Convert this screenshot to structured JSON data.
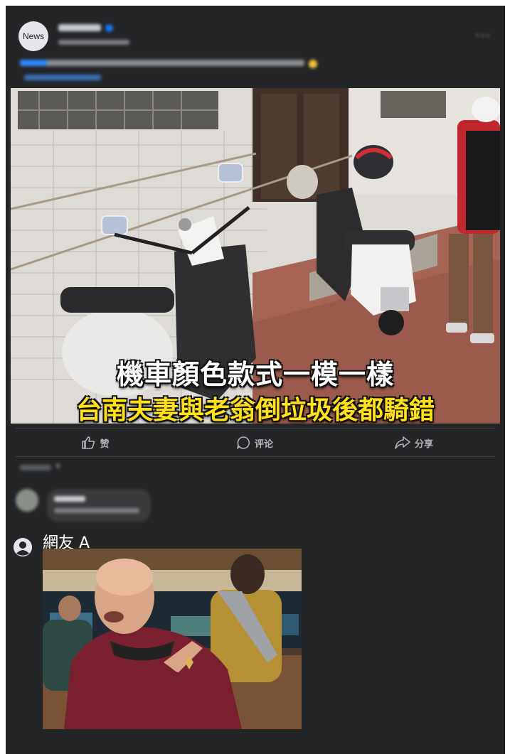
{
  "post": {
    "page_avatar_label": "News",
    "more_icon": "more-horizontal-icon",
    "photo_overlay": {
      "line_1": "機車顏色款式一模一樣",
      "line_2": "台南夫妻與老翁倒垃圾後都騎錯"
    }
  },
  "actions": {
    "like_label": "赞",
    "comment_label": "评论",
    "share_label": "分享"
  },
  "comment": {
    "author": "網友 A",
    "avatar_icon": "user-icon",
    "attachment": "meme-image"
  },
  "colors": {
    "card_background": "#242526",
    "overlay_white": "#ffffff",
    "overlay_yellow": "#ffe01a",
    "action_text": "#b0b3b8"
  }
}
